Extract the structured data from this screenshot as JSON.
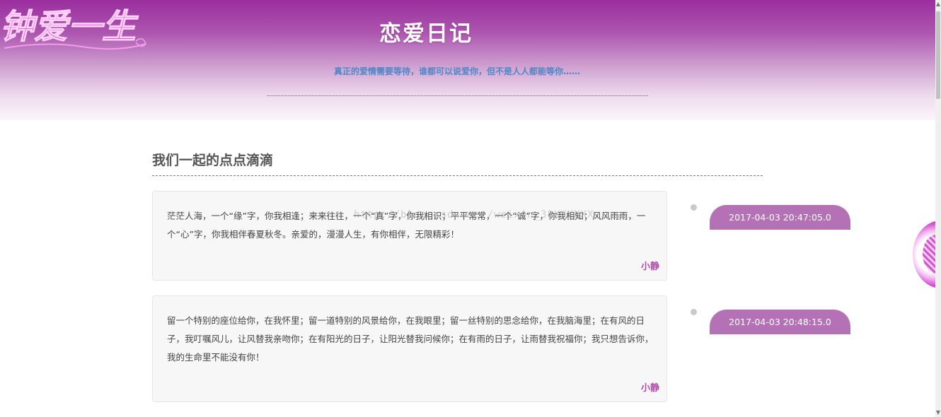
{
  "header": {
    "logo_text": "钟爱一生",
    "title": "恋爱日记",
    "tagline": "真正的爱情需要等待，谁都可以说爱你，但不是人人都能等你……"
  },
  "section": {
    "title": "我们一起的点点滴滴"
  },
  "entries": [
    {
      "text": "茫茫人海，一个“缘”字，你我相逢；来来往往，一个“真”字，你我相识；平平常常，一个“诚”字，你我相知；风风雨雨，一个“心”字，你我相伴春夏秋冬。亲爱的，漫漫人生，有你相伴，无限精彩！",
      "author": "小静",
      "date": "2017-04-03 20:47:05.0"
    },
    {
      "text": "留一个特别的座位给你，在我怀里；留一道特别的风景给你，在我眼里；留一丝特别的思念给你，在我脑海里；在有风的日子，我叮嘱风儿，让风替我亲吻你；在有阳光的日子，让阳光替我问候你；在有雨的日子，让雨替我祝福你；我只想告诉你，我的生命里不能没有你！",
      "author": "小静",
      "date": "2017-04-03 20:48:15.0"
    }
  ],
  "watermark": "http://blog.csdn.net/weixin_38XXXXXX",
  "colors": {
    "header_top": "#9a2e9e",
    "accent": "#b571b6",
    "author": "#b04fa6",
    "tagline": "#4f86c6"
  },
  "icons": {
    "logo": "calligraphy-logo",
    "side_widget": "floating-avatar-widget"
  }
}
